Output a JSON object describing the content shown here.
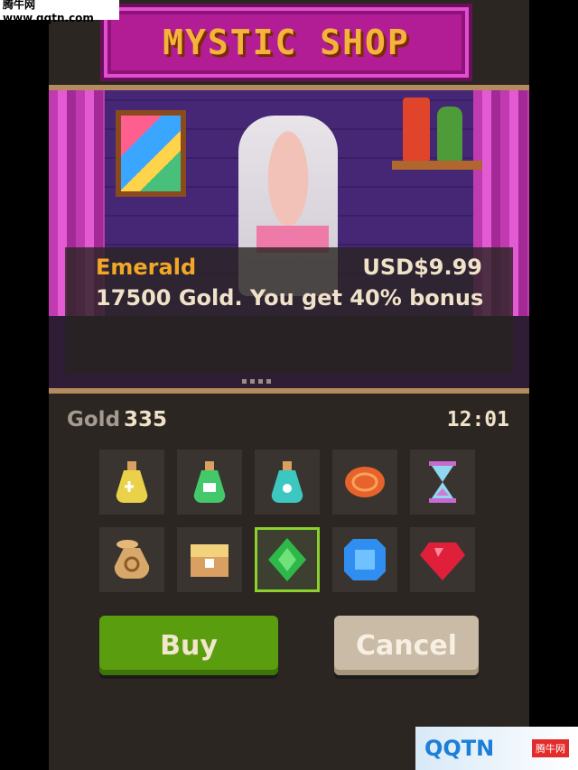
{
  "watermark_top": "腾牛网 www.qqtn.com",
  "shop": {
    "title": "MYSTIC SHOP"
  },
  "selected_item": {
    "name": "Emerald",
    "price": "USD$9.99",
    "description": "17500 Gold. You get 40% bonus"
  },
  "status": {
    "gold_label": "Gold",
    "gold_value": "335",
    "time": "12:01"
  },
  "items": [
    {
      "icon": "yellow-potion-icon",
      "color": "#e9d24a"
    },
    {
      "icon": "green-potion-icon",
      "color": "#43c96a"
    },
    {
      "icon": "teal-potion-icon",
      "color": "#3cc8c0"
    },
    {
      "icon": "orange-coin-icon",
      "color": "#e8622c"
    },
    {
      "icon": "hourglass-icon",
      "color": "#d07ad0"
    },
    {
      "icon": "gold-bag-icon",
      "color": "#d8a86a"
    },
    {
      "icon": "treasure-chest-icon",
      "color": "#e2c07a"
    },
    {
      "icon": "emerald-icon",
      "color": "#2fb84a"
    },
    {
      "icon": "sapphire-icon",
      "color": "#2f8ef0"
    },
    {
      "icon": "ruby-icon",
      "color": "#e0203a"
    }
  ],
  "selected_index": 7,
  "buttons": {
    "buy": "Buy",
    "cancel": "Cancel"
  },
  "watermark_bottom": {
    "logo": "QQTN",
    "badge": "腾牛网"
  },
  "colors": {
    "accent_green": "#5a9d0f",
    "gold_text": "#f2a826"
  }
}
